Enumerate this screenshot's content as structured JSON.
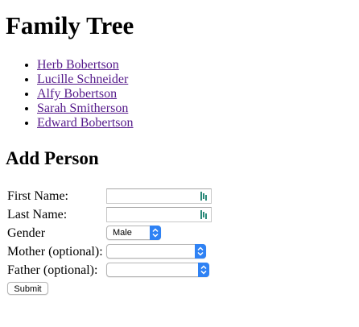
{
  "page": {
    "title": "Family Tree"
  },
  "people": [
    {
      "name": "Herb Bobertson"
    },
    {
      "name": "Lucille Schneider"
    },
    {
      "name": "Alfy Bobertson"
    },
    {
      "name": "Sarah Smitherson"
    },
    {
      "name": "Edward Bobertson"
    }
  ],
  "form": {
    "heading": "Add Person",
    "first_name": {
      "label": "First Name:",
      "value": ""
    },
    "last_name": {
      "label": "Last Name:",
      "value": ""
    },
    "gender": {
      "label": "Gender",
      "selected": "Male"
    },
    "mother": {
      "label": "Mother (optional):",
      "selected": ""
    },
    "father": {
      "label": "Father (optional):",
      "selected": ""
    },
    "submit_label": "Submit"
  },
  "colors": {
    "link": "#551a8b",
    "stepper": "#2f82f4"
  }
}
